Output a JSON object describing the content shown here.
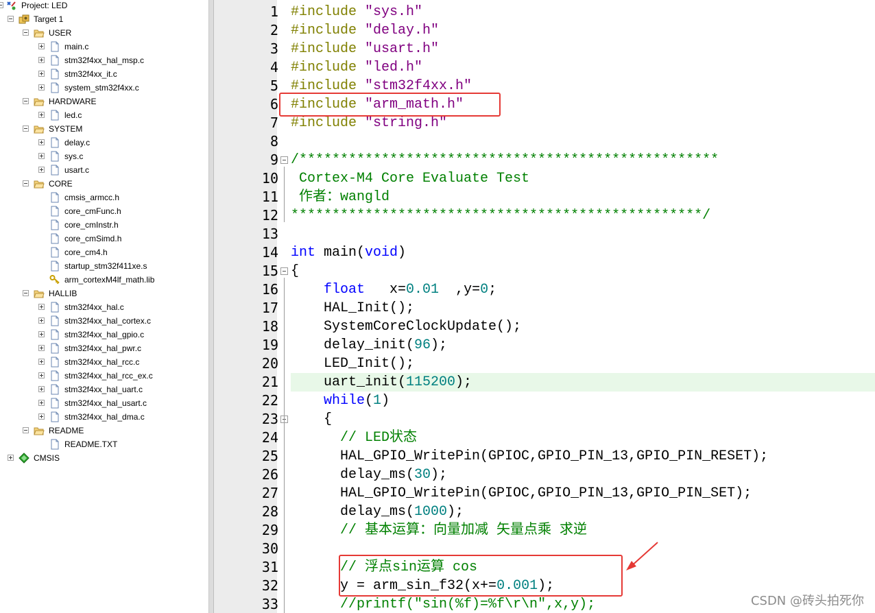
{
  "tree": {
    "items": [
      {
        "label": "Project: LED",
        "depth": 0,
        "kind": "project",
        "toggle": "minus"
      },
      {
        "label": "Target 1",
        "depth": 1,
        "kind": "target",
        "toggle": "minus"
      },
      {
        "label": "USER",
        "depth": 2,
        "kind": "folder",
        "toggle": "minus"
      },
      {
        "label": "main.c",
        "depth": 3,
        "kind": "file",
        "toggle": "plus"
      },
      {
        "label": "stm32f4xx_hal_msp.c",
        "depth": 3,
        "kind": "file",
        "toggle": "plus"
      },
      {
        "label": "stm32f4xx_it.c",
        "depth": 3,
        "kind": "file",
        "toggle": "plus"
      },
      {
        "label": "system_stm32f4xx.c",
        "depth": 3,
        "kind": "file",
        "toggle": "plus"
      },
      {
        "label": "HARDWARE",
        "depth": 2,
        "kind": "folder",
        "toggle": "minus"
      },
      {
        "label": "led.c",
        "depth": 3,
        "kind": "file",
        "toggle": "plus"
      },
      {
        "label": "SYSTEM",
        "depth": 2,
        "kind": "folder",
        "toggle": "minus"
      },
      {
        "label": "delay.c",
        "depth": 3,
        "kind": "file",
        "toggle": "plus"
      },
      {
        "label": "sys.c",
        "depth": 3,
        "kind": "file",
        "toggle": "plus"
      },
      {
        "label": "usart.c",
        "depth": 3,
        "kind": "file",
        "toggle": "plus"
      },
      {
        "label": "CORE",
        "depth": 2,
        "kind": "folder",
        "toggle": "minus"
      },
      {
        "label": "cmsis_armcc.h",
        "depth": 3,
        "kind": "file",
        "toggle": "none"
      },
      {
        "label": "core_cmFunc.h",
        "depth": 3,
        "kind": "file",
        "toggle": "none"
      },
      {
        "label": "core_cmInstr.h",
        "depth": 3,
        "kind": "file",
        "toggle": "none"
      },
      {
        "label": "core_cmSimd.h",
        "depth": 3,
        "kind": "file",
        "toggle": "none"
      },
      {
        "label": "core_cm4.h",
        "depth": 3,
        "kind": "file",
        "toggle": "none"
      },
      {
        "label": "startup_stm32f411xe.s",
        "depth": 3,
        "kind": "file",
        "toggle": "none"
      },
      {
        "label": "arm_cortexM4lf_math.lib",
        "depth": 3,
        "kind": "lib",
        "toggle": "none"
      },
      {
        "label": "HALLIB",
        "depth": 2,
        "kind": "folder",
        "toggle": "minus"
      },
      {
        "label": "stm32f4xx_hal.c",
        "depth": 3,
        "kind": "file",
        "toggle": "plus"
      },
      {
        "label": "stm32f4xx_hal_cortex.c",
        "depth": 3,
        "kind": "file",
        "toggle": "plus"
      },
      {
        "label": "stm32f4xx_hal_gpio.c",
        "depth": 3,
        "kind": "file",
        "toggle": "plus"
      },
      {
        "label": "stm32f4xx_hal_pwr.c",
        "depth": 3,
        "kind": "file",
        "toggle": "plus"
      },
      {
        "label": "stm32f4xx_hal_rcc.c",
        "depth": 3,
        "kind": "file",
        "toggle": "plus"
      },
      {
        "label": "stm32f4xx_hal_rcc_ex.c",
        "depth": 3,
        "kind": "file",
        "toggle": "plus"
      },
      {
        "label": "stm32f4xx_hal_uart.c",
        "depth": 3,
        "kind": "file",
        "toggle": "plus"
      },
      {
        "label": "stm32f4xx_hal_usart.c",
        "depth": 3,
        "kind": "file",
        "toggle": "plus"
      },
      {
        "label": "stm32f4xx_hal_dma.c",
        "depth": 3,
        "kind": "file",
        "toggle": "plus"
      },
      {
        "label": "README",
        "depth": 2,
        "kind": "folder",
        "toggle": "minus"
      },
      {
        "label": "README.TXT",
        "depth": 3,
        "kind": "file",
        "toggle": "none"
      },
      {
        "label": "CMSIS",
        "depth": 1,
        "kind": "cmsis",
        "toggle": "plus"
      }
    ]
  },
  "editor": {
    "lines": [
      {
        "n": "1",
        "tokens": [
          [
            "#include",
            "pp"
          ],
          [
            " ",
            ""
          ],
          [
            "\"sys.h\"",
            "str"
          ]
        ]
      },
      {
        "n": "2",
        "tokens": [
          [
            "#include",
            "pp"
          ],
          [
            " ",
            ""
          ],
          [
            "\"delay.h\"",
            "str"
          ]
        ]
      },
      {
        "n": "3",
        "tokens": [
          [
            "#include",
            "pp"
          ],
          [
            " ",
            ""
          ],
          [
            "\"usart.h\"",
            "str"
          ]
        ]
      },
      {
        "n": "4",
        "tokens": [
          [
            "#include",
            "pp"
          ],
          [
            " ",
            ""
          ],
          [
            "\"led.h\"",
            "str"
          ]
        ]
      },
      {
        "n": "5",
        "tokens": [
          [
            "#include",
            "pp"
          ],
          [
            " ",
            ""
          ],
          [
            "\"stm32f4xx.h\"",
            "str"
          ]
        ]
      },
      {
        "n": "6",
        "tokens": [
          [
            "#include",
            "pp"
          ],
          [
            " ",
            ""
          ],
          [
            "\"arm_math.h\"",
            "str"
          ]
        ]
      },
      {
        "n": "7",
        "tokens": [
          [
            "#include",
            "pp"
          ],
          [
            " ",
            ""
          ],
          [
            "\"string.h\"",
            "str"
          ]
        ]
      },
      {
        "n": "8",
        "tokens": []
      },
      {
        "n": "9",
        "fold": "open",
        "tokens": [
          [
            "/***************************************************",
            "cmt"
          ]
        ]
      },
      {
        "n": "10",
        "tokens": [
          [
            " Cortex-M4 Core Evaluate Test",
            "cmt"
          ]
        ]
      },
      {
        "n": "11",
        "tokens": [
          [
            " 作者：wangld",
            "cmt"
          ]
        ]
      },
      {
        "n": "12",
        "tokens": [
          [
            "**************************************************/",
            "cmt"
          ]
        ]
      },
      {
        "n": "13",
        "tokens": []
      },
      {
        "n": "14",
        "tokens": [
          [
            "int",
            "kw"
          ],
          [
            " main(",
            ""
          ],
          [
            "void",
            "kw"
          ],
          [
            ")",
            ""
          ]
        ]
      },
      {
        "n": "15",
        "fold": "open",
        "tokens": [
          [
            "{",
            ""
          ]
        ]
      },
      {
        "n": "16",
        "tokens": [
          [
            "    ",
            ""
          ],
          [
            "float",
            "kw"
          ],
          [
            "   x=",
            ""
          ],
          [
            "0.01",
            "num"
          ],
          [
            "  ,y=",
            ""
          ],
          [
            "0",
            "num"
          ],
          [
            ";",
            ""
          ]
        ]
      },
      {
        "n": "17",
        "tokens": [
          [
            "    HAL_Init();",
            ""
          ]
        ]
      },
      {
        "n": "18",
        "tokens": [
          [
            "    SystemCoreClockUpdate();",
            ""
          ]
        ]
      },
      {
        "n": "19",
        "tokens": [
          [
            "    delay_init(",
            ""
          ],
          [
            "96",
            "num"
          ],
          [
            ");",
            ""
          ]
        ]
      },
      {
        "n": "20",
        "tokens": [
          [
            "    LED_Init();",
            ""
          ]
        ]
      },
      {
        "n": "21",
        "highlight": true,
        "tokens": [
          [
            "    uart_init(",
            ""
          ],
          [
            "115200",
            "num"
          ],
          [
            ");",
            ""
          ]
        ]
      },
      {
        "n": "22",
        "tokens": [
          [
            "    ",
            ""
          ],
          [
            "while",
            "kw"
          ],
          [
            "(",
            ""
          ],
          [
            "1",
            "num"
          ],
          [
            ")",
            ""
          ]
        ]
      },
      {
        "n": "23",
        "fold": "open",
        "tokens": [
          [
            "    {",
            ""
          ]
        ]
      },
      {
        "n": "24",
        "tokens": [
          [
            "      ",
            ""
          ],
          [
            "// LED状态",
            "cmt"
          ]
        ]
      },
      {
        "n": "25",
        "tokens": [
          [
            "      HAL_GPIO_WritePin(GPIOC,GPIO_PIN_13,GPIO_PIN_RESET);",
            ""
          ]
        ]
      },
      {
        "n": "26",
        "tokens": [
          [
            "      delay_ms(",
            ""
          ],
          [
            "30",
            "num"
          ],
          [
            ");",
            ""
          ]
        ]
      },
      {
        "n": "27",
        "tokens": [
          [
            "      HAL_GPIO_WritePin(GPIOC,GPIO_PIN_13,GPIO_PIN_SET);",
            ""
          ]
        ]
      },
      {
        "n": "28",
        "tokens": [
          [
            "      delay_ms(",
            ""
          ],
          [
            "1000",
            "num"
          ],
          [
            ");",
            ""
          ]
        ]
      },
      {
        "n": "29",
        "tokens": [
          [
            "      ",
            ""
          ],
          [
            "// 基本运算：向量加减 矢量点乘 求逆",
            "cmt"
          ]
        ]
      },
      {
        "n": "30",
        "tokens": []
      },
      {
        "n": "31",
        "tokens": [
          [
            "      ",
            ""
          ],
          [
            "// 浮点sin运算 cos",
            "cmt"
          ]
        ]
      },
      {
        "n": "32",
        "tokens": [
          [
            "      y = arm_sin_f32(x+=",
            ""
          ],
          [
            "0.001",
            "num"
          ],
          [
            ");",
            ""
          ]
        ]
      },
      {
        "n": "33",
        "tokens": [
          [
            "      ",
            ""
          ],
          [
            "//printf(\"sin(%f)=%f\\r\\n\",x,y);",
            "cmt"
          ]
        ]
      }
    ]
  },
  "colors": {
    "preprocessor": "#808000",
    "string": "#800080",
    "comment": "#008000",
    "keyword": "#0000ff",
    "number": "#008080",
    "highlight": "#e8f8e8",
    "annotation": "#e53935"
  },
  "watermark": "CSDN @砖头拍死你"
}
